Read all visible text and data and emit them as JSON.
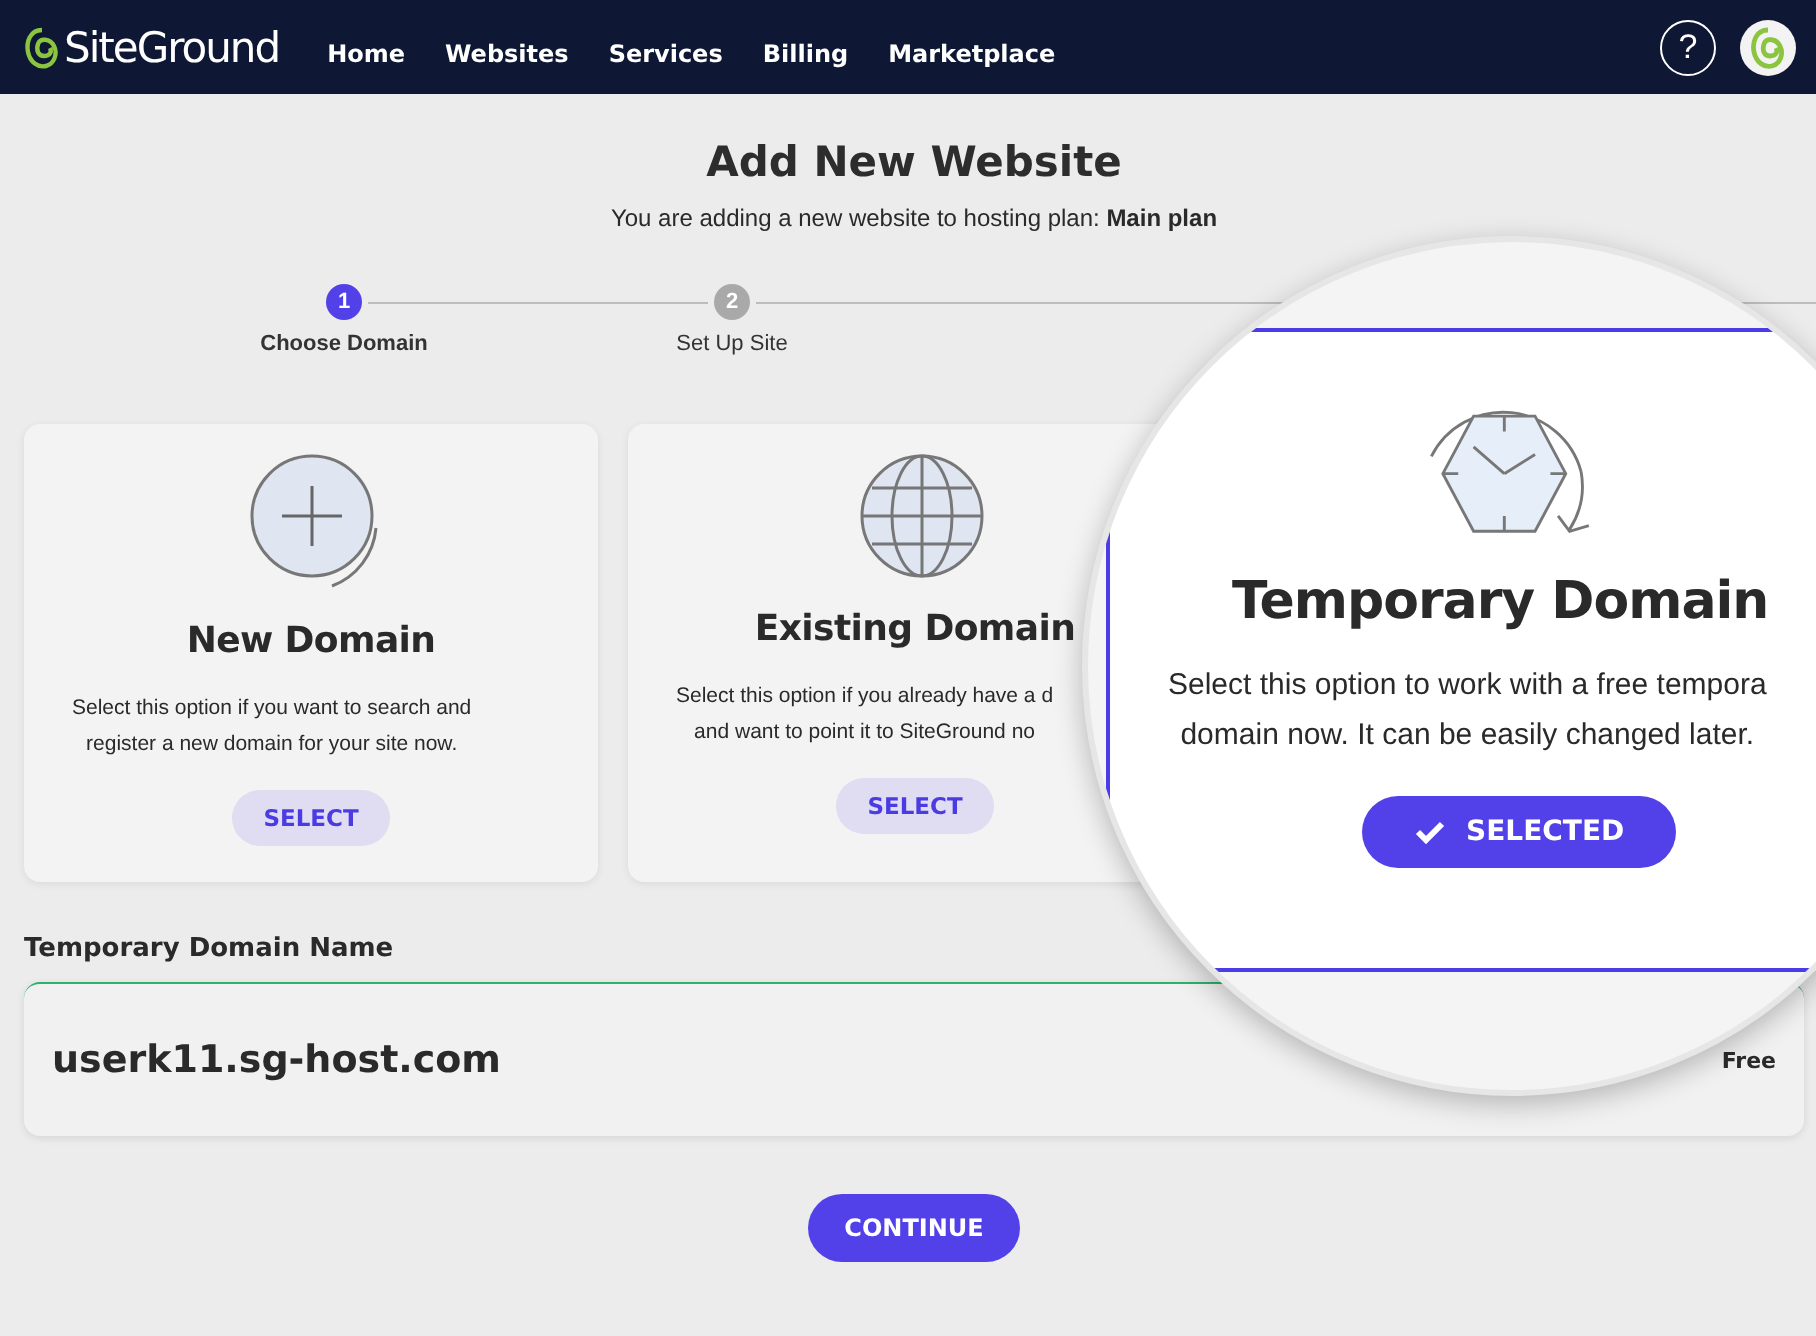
{
  "nav": {
    "brand": "SiteGround",
    "links": [
      {
        "label": "Home"
      },
      {
        "label": "Websites"
      },
      {
        "label": "Services"
      },
      {
        "label": "Billing"
      },
      {
        "label": "Marketplace"
      }
    ],
    "help": "?"
  },
  "page": {
    "title": "Add New Website",
    "subtitle": "You are adding a new website to hosting plan: **Main plan**"
  },
  "steps": [
    {
      "number": "1",
      "label": "Choose Domain",
      "selected": true
    },
    {
      "number": "2",
      "label": "Set Up Site",
      "selected": false
    }
  ],
  "options": [
    {
      "kind": "plus",
      "title": "New Domain",
      "description_lines": [
        "Select this option if you want to search and",
        "register a new domain for your site now."
      ],
      "button": "SELECT",
      "selected": false
    },
    {
      "kind": "globe",
      "title": "Existing Domain",
      "description_lines": [
        "Select this option if you already have a d",
        "and want to point it to SiteGround no"
      ],
      "button": "SELECT",
      "selected": false
    }
  ],
  "magnified_option": {
    "kind": "clock",
    "title": "Temporary Domain",
    "description_lines": [
      "Select this option to work with a free tempora",
      "domain now. It can be easily changed later."
    ],
    "button": "SELECTED",
    "selected": true
  },
  "domain_field": {
    "label": "Temporary Domain Name",
    "value": "userk11.sg-host.com",
    "price": "Free"
  },
  "continue_button": "CONTINUE"
}
